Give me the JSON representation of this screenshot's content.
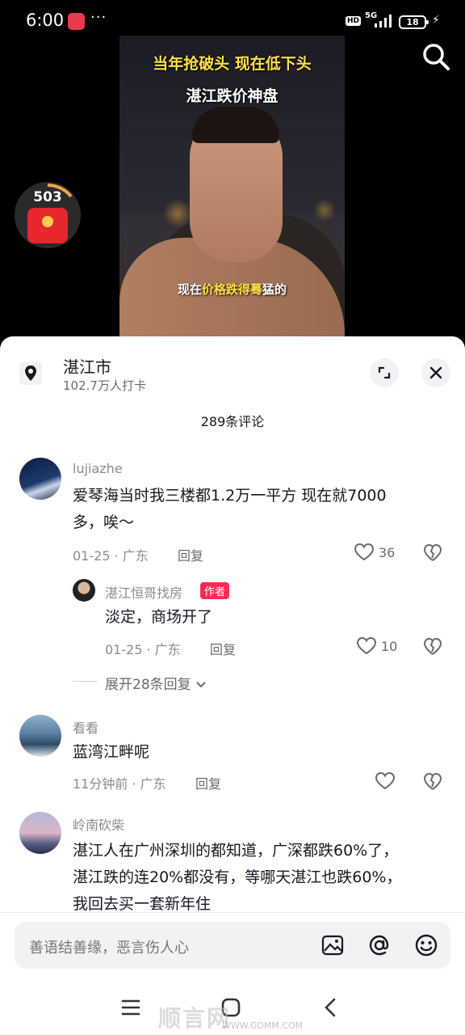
{
  "status": {
    "time": "6:00",
    "more": "···",
    "hd": "HD",
    "net": "5G",
    "battery": "18"
  },
  "video": {
    "caption_line1": "当年抢破头 现在低下头",
    "caption_line2": "湛江跌价神盘",
    "subtitle_pre": "现在",
    "subtitle_hl": "价格跌得蓦",
    "subtitle_post": "猛的"
  },
  "redpacket": {
    "count": "503"
  },
  "location": {
    "name": "湛江市",
    "checkins": "102.7万人打卡"
  },
  "comments_header": {
    "count_label": "289条评论"
  },
  "comments": [
    {
      "user": "lujiazhe",
      "text_line1": "爱琴海当时我三楼都1.2万一平方 现在就7000",
      "text_line2": "多，唉～",
      "date": "01-25",
      "region": "广东",
      "reply": "回复",
      "likes": "36"
    },
    {
      "user": "湛江恒哥找房",
      "badge": "作者",
      "text": "淡定，商场开了",
      "date": "01-25",
      "region": "广东",
      "reply": "回复",
      "likes": "10"
    },
    {
      "user": "看看",
      "text": "蓝湾江畔呢",
      "date": "11分钟前",
      "region": "广东",
      "reply": "回复"
    },
    {
      "user": "岭南砍柴",
      "text_line1": "湛江人在广州深圳的都知道，广深都跌60%了，",
      "text_line2": "湛江跌的连20%都没有，等哪天湛江也跌60%，",
      "text_line3": "我回去买一套新年住"
    }
  ],
  "expand_replies": "展开28条回复",
  "input": {
    "placeholder": "善语结善缘，恶言伤人心"
  },
  "watermark": {
    "main": "顺言网",
    "url": "WWW.GDMM.COM"
  }
}
